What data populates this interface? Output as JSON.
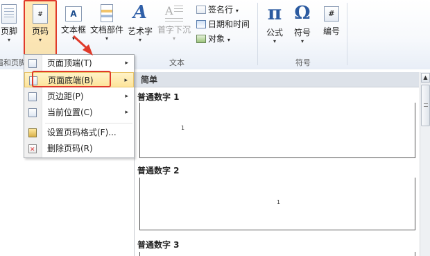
{
  "ribbon": {
    "footer_label": "页脚",
    "page_number_label": "页码",
    "page_number_icon_text": "#",
    "textbox_label": "文本框",
    "textbox_icon_text": "A",
    "quickparts_label": "文档部件",
    "wordart_label": "艺术字",
    "wordart_icon_text": "A",
    "dropcap_label": "首字下沉",
    "signature_label": "签名行",
    "datetime_label": "日期和时间",
    "object_label": "对象",
    "equation_label": "公式",
    "equation_icon_text": "π",
    "symbol_label": "符号",
    "symbol_icon_text": "Ω",
    "number_label": "编号",
    "number_icon_text": "#",
    "dropdown_arrow": "▾"
  },
  "groups": {
    "header_footer": "眉和页脚",
    "text": "文本",
    "symbols": "符号"
  },
  "menu": {
    "items": [
      {
        "label": "页面顶端(T)",
        "submenu": "▸"
      },
      {
        "label": "页面底端(B)",
        "submenu": "▸"
      },
      {
        "label": "页边距(P)",
        "submenu": "▸"
      },
      {
        "label": "当前位置(C)",
        "submenu": "▸"
      },
      {
        "label": "设置页码格式(F)..."
      },
      {
        "label": "删除页码(R)"
      }
    ]
  },
  "gallery": {
    "header": "简单",
    "options": [
      {
        "title": "普通数字 1",
        "preview_number": "1"
      },
      {
        "title": "普通数字 2",
        "preview_number": "1"
      },
      {
        "title": "普通数字 3"
      }
    ],
    "scroll_up": "▲",
    "colors": {
      "highlight": "#e03a2a",
      "hot_item": "#fde49a"
    }
  }
}
